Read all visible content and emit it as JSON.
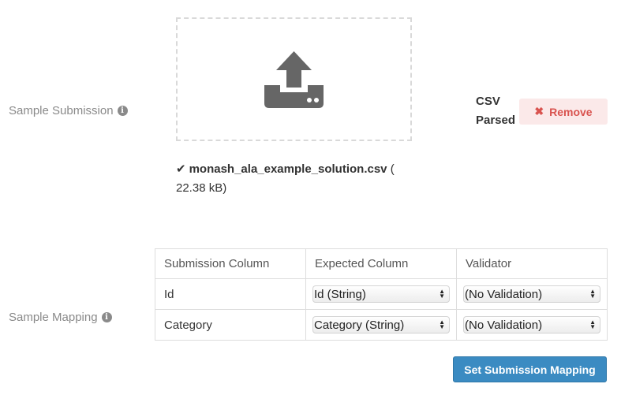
{
  "submission": {
    "label": "Sample Submission",
    "file_check": "✔",
    "file_name": "monash_ala_example_solution.csv",
    "file_size_open": " (",
    "file_size": "22.38 kB)",
    "status_line1": "CSV",
    "status_line2": "Parsed",
    "remove_icon": "✖",
    "remove_label": "Remove",
    "upload_icon": "upload-icon"
  },
  "mapping": {
    "label": "Sample Mapping",
    "headers": [
      "Submission Column",
      "Expected Column",
      "Validator"
    ],
    "rows": [
      {
        "submission": "Id",
        "expected": "Id (String)",
        "validator": "(No Validation)"
      },
      {
        "submission": "Category",
        "expected": "Category (String)",
        "validator": "(No Validation)"
      }
    ],
    "submit_label": "Set Submission Mapping"
  },
  "info_icon_glyph": "i",
  "colors": {
    "remove_bg": "#fbe9e9",
    "remove_text": "#d9534f",
    "primary": "#3b8bc2",
    "upload_icon": "#666666"
  }
}
